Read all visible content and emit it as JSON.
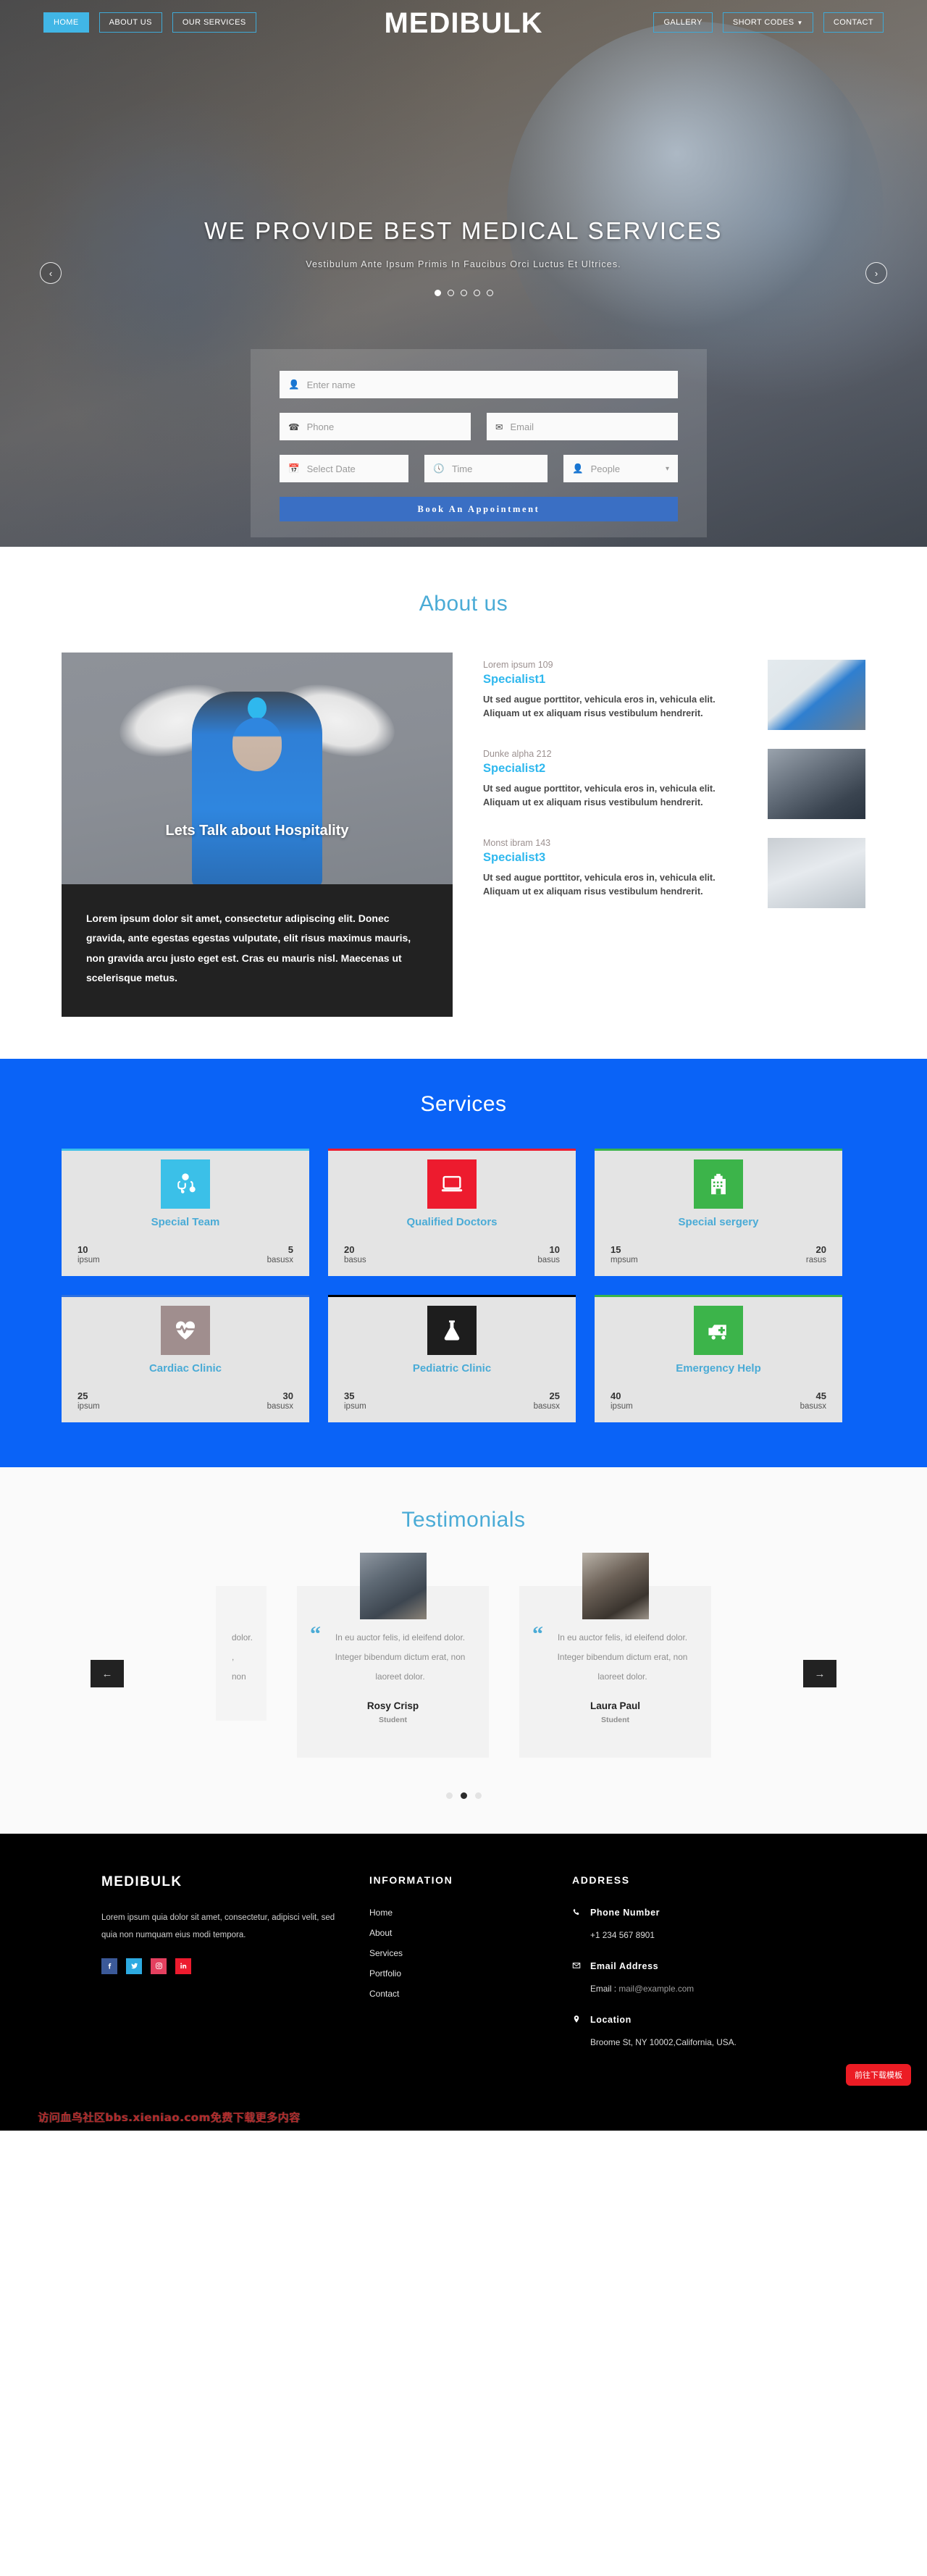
{
  "brand": "MEDIBULK",
  "nav": {
    "left": [
      {
        "label": "HOME",
        "active": true
      },
      {
        "label": "ABOUT US",
        "active": false
      },
      {
        "label": "OUR SERVICES",
        "active": false
      }
    ],
    "right": [
      {
        "label": "GALLERY",
        "caret": false
      },
      {
        "label": "SHORT CODES",
        "caret": true
      },
      {
        "label": "CONTACT",
        "caret": false
      }
    ]
  },
  "hero": {
    "title": "WE PROVIDE BEST MEDICAL SERVICES",
    "subtitle": "Vestibulum Ante Ipsum Primis In Faucibus Orci Luctus Et Ultrices.",
    "dots": 5,
    "active_dot": 0,
    "prev_arrow": "‹",
    "next_arrow": "›"
  },
  "appointment": {
    "name_placeholder": "Enter name",
    "phone_placeholder": "Phone",
    "email_placeholder": "Email",
    "date_placeholder": "Select Date",
    "time_placeholder": "Time",
    "people_placeholder": "People",
    "submit_label": "Book An Appointment"
  },
  "about": {
    "title": "About us",
    "card_title": "Lets Talk about Hospitality",
    "card_text": "Lorem ipsum dolor sit amet, consectetur adipiscing elit. Donec gravida, ante egestas egestas vulputate, elit risus maximus mauris, non gravida arcu justo eget est. Cras eu mauris nisl. Maecenas ut scelerisque metus.",
    "specialists": [
      {
        "meta": "Lorem ipsum 109",
        "name": "Specialist1",
        "desc": "Ut sed augue porttitor, vehicula eros in, vehicula elit. Aliquam ut ex aliquam risus vestibulum hendrerit."
      },
      {
        "meta": "Dunke alpha 212",
        "name": "Specialist2",
        "desc": "Ut sed augue porttitor, vehicula eros in, vehicula elit. Aliquam ut ex aliquam risus vestibulum hendrerit."
      },
      {
        "meta": "Monst ibram 143",
        "name": "Specialist3",
        "desc": "Ut sed augue porttitor, vehicula eros in, vehicula elit. Aliquam ut ex aliquam risus vestibulum hendrerit."
      }
    ]
  },
  "services": {
    "title": "Services",
    "bg_color": "#0a63f7",
    "cards": [
      {
        "name": "Special Team",
        "icon": "doctor-icon",
        "icon_bg": "#3bc0e8",
        "top_bar": "#3bc0e8",
        "left_num": "10",
        "left_lbl": "ipsum",
        "right_num": "5",
        "right_lbl": "basusx"
      },
      {
        "name": "Qualified Doctors",
        "icon": "laptop-icon",
        "icon_bg": "#ed1b2e",
        "top_bar": "#ed1b2e",
        "left_num": "20",
        "left_lbl": "basus",
        "right_num": "10",
        "right_lbl": "basus"
      },
      {
        "name": "Special sergery",
        "icon": "hospital-icon",
        "icon_bg": "#3cb44a",
        "top_bar": "#3cb44a",
        "left_num": "15",
        "left_lbl": "mpsum",
        "right_num": "20",
        "right_lbl": "rasus"
      },
      {
        "name": "Cardiac Clinic",
        "icon": "heartbeat-icon",
        "icon_bg": "#a08e8e",
        "top_bar": "#2b6fe0",
        "left_num": "25",
        "left_lbl": "ipsum",
        "right_num": "30",
        "right_lbl": "basusx"
      },
      {
        "name": "Pediatric Clinic",
        "icon": "flask-icon",
        "icon_bg": "#1d1d1d",
        "top_bar": "#000000",
        "left_num": "35",
        "left_lbl": "ipsum",
        "right_num": "25",
        "right_lbl": "basusx"
      },
      {
        "name": "Emergency Help",
        "icon": "ambulance-icon",
        "icon_bg": "#3cb44a",
        "top_bar": "#3cb44a",
        "left_num": "40",
        "left_lbl": "ipsum",
        "right_num": "45",
        "right_lbl": "basusx"
      }
    ]
  },
  "testimonials": {
    "title": "Testimonials",
    "quote_glyph": "“",
    "prev_arrow": "←",
    "next_arrow": "→",
    "dots": 3,
    "active_dot": 1,
    "ghost_text": "dolor.",
    "ghost_text2": ", non",
    "items": [
      {
        "text": "In eu auctor felis, id eleifend dolor. Integer bibendum dictum erat, non laoreet dolor.",
        "name": "Rosy Crisp",
        "role": "Student"
      },
      {
        "text": "In eu auctor felis, id eleifend dolor. Integer bibendum dictum erat, non laoreet dolor.",
        "name": "Laura Paul",
        "role": "Student"
      }
    ]
  },
  "footer": {
    "brand": "MEDIBULK",
    "description": "Lorem ipsum quia dolor sit amet, consectetur, adipisci velit, sed quia non numquam eius modi tempora.",
    "socials": [
      {
        "name": "facebook-icon",
        "glyph": "f",
        "color": "#3b5998"
      },
      {
        "name": "twitter-icon",
        "glyph": "t",
        "color": "#2daae1"
      },
      {
        "name": "instagram-icon",
        "glyph": "ig",
        "color": "#e4405f"
      },
      {
        "name": "linkedin-icon",
        "glyph": "in",
        "color": "#ed1b2e"
      }
    ],
    "information_heading": "INFORMATION",
    "links": [
      "Home",
      "About",
      "Services",
      "Portfolio",
      "Contact"
    ],
    "address_heading": "ADDRESS",
    "contacts": [
      {
        "icon": "phone-icon",
        "label": "Phone Number",
        "value": "+1 234 567 8901",
        "prefix": ""
      },
      {
        "icon": "envelope-icon",
        "label": "Email Address",
        "value": "mail@example.com",
        "prefix": "Email : "
      },
      {
        "icon": "pin-icon",
        "label": "Location",
        "value": "Broome St, NY 10002,California, USA.",
        "prefix": ""
      }
    ],
    "download_button": "前往下载模板",
    "watermark": "访问血鸟社区bbs.xieniao.com免费下载更多内容"
  }
}
